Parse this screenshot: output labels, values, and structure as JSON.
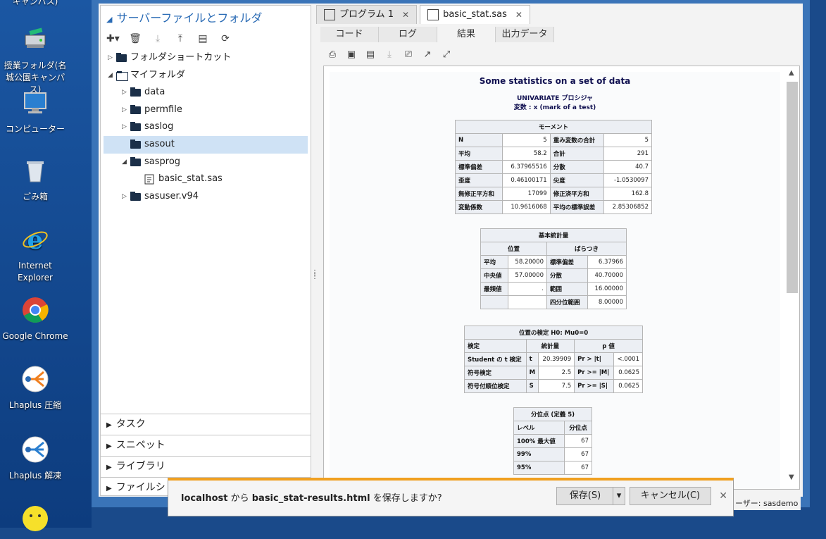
{
  "desktop": {
    "top_partial_label": "キャンパス)",
    "icons": [
      {
        "label": "授業フォルダ(名城公園キャンパス)",
        "icon": "network-drive-icon"
      },
      {
        "label": "コンピューター",
        "icon": "computer-icon"
      },
      {
        "label": "ごみ箱",
        "icon": "recycle-bin-icon"
      },
      {
        "label": "Internet Explorer",
        "icon": "internet-explorer-icon"
      },
      {
        "label": "Google Chrome",
        "icon": "google-chrome-icon"
      },
      {
        "label": "Lhaplus 圧縮",
        "icon": "lhaplus-compress-icon"
      },
      {
        "label": "Lhaplus 解凍",
        "icon": "lhaplus-extract-icon"
      }
    ]
  },
  "left_panel": {
    "title": "サーバーファイルとフォルダ",
    "tree": [
      {
        "label": "フォルダショートカット",
        "level": 0,
        "expanded": false
      },
      {
        "label": "マイフォルダ",
        "level": 0,
        "expanded": true
      },
      {
        "label": "data",
        "level": 1,
        "expanded": false
      },
      {
        "label": "permfile",
        "level": 1,
        "expanded": false
      },
      {
        "label": "saslog",
        "level": 1,
        "expanded": false
      },
      {
        "label": "sasout",
        "level": 1,
        "selected": true
      },
      {
        "label": "sasprog",
        "level": 1,
        "expanded": true
      },
      {
        "label": "basic_stat.sas",
        "level": 2,
        "file": true
      },
      {
        "label": "sasuser.v94",
        "level": 1,
        "expanded": false
      }
    ],
    "sections": [
      "タスク",
      "スニペット",
      "ライブラリ",
      "ファイルシ"
    ]
  },
  "tabs": [
    {
      "label": "プログラム 1"
    },
    {
      "label": "basic_stat.sas",
      "active": true
    }
  ],
  "subtabs": [
    "コード",
    "ログ",
    "結果",
    "出力データ"
  ],
  "active_subtab": "結果",
  "report": {
    "title": "Some statistics on a set of data",
    "proc": "UNIVARIATE プロシジャ",
    "variable": "変数 : x (mark of a test)",
    "moments": {
      "caption": "モーメント",
      "rows": [
        [
          "N",
          "5",
          "重み変数の合計",
          "5"
        ],
        [
          "平均",
          "58.2",
          "合計",
          "291"
        ],
        [
          "標準偏差",
          "6.37965516",
          "分散",
          "40.7"
        ],
        [
          "歪度",
          "0.46100171",
          "尖度",
          "-1.0530097"
        ],
        [
          "無修正平方和",
          "17099",
          "修正済平方和",
          "162.8"
        ],
        [
          "変動係数",
          "10.9616068",
          "平均の標準誤差",
          "2.85306852"
        ]
      ]
    },
    "basic": {
      "caption": "基本統計量",
      "h1": "位置",
      "h2": "ばらつき",
      "rows": [
        [
          "平均",
          "58.20000",
          "標準偏差",
          "6.37966"
        ],
        [
          "中央値",
          "57.00000",
          "分散",
          "40.70000"
        ],
        [
          "最頻値",
          ".",
          "範囲",
          "16.00000"
        ],
        [
          "",
          "",
          "四分位範囲",
          "8.00000"
        ]
      ]
    },
    "location": {
      "caption": "位置の検定 H0: Mu0=0",
      "h": [
        "検定",
        "統計量",
        "p 値"
      ],
      "rows": [
        [
          "Student の t 検定",
          "t",
          "20.39909",
          "Pr > |t|",
          "<.0001"
        ],
        [
          "符号検定",
          "M",
          "2.5",
          "Pr >= |M|",
          "0.0625"
        ],
        [
          "符号付順位検定",
          "S",
          "7.5",
          "Pr >= |S|",
          "0.0625"
        ]
      ]
    },
    "quantiles": {
      "caption": "分位点 (定義 5)",
      "h": [
        "レベル",
        "分位点"
      ],
      "rows": [
        [
          "100% 最大値",
          "67"
        ],
        [
          "99%",
          "67"
        ],
        [
          "95%",
          "67"
        ]
      ]
    }
  },
  "download_bar": {
    "host": "localhost",
    "from": " から ",
    "file": "basic_stat-results.html",
    "question": " を保存しますか?",
    "save": "保存(S)",
    "cancel": "キャンセル(C)"
  },
  "status_text": "ーザー: sasdemo"
}
